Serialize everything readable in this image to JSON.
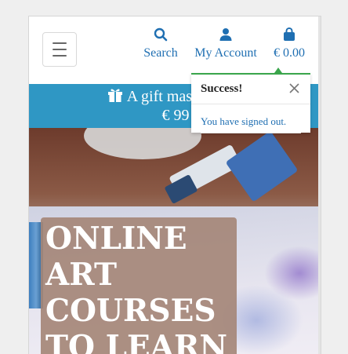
{
  "header": {
    "menu_toggle": "menu",
    "search_label": "Search",
    "account_label": "My Account",
    "bag_total": "€ 0.00"
  },
  "promo": {
    "line1": "A gift master-class",
    "line2": "€ 99"
  },
  "hero": {
    "headline_lines": [
      "ONLINE",
      "ART",
      "COURSES",
      "TO LEARN"
    ]
  },
  "toast": {
    "title": "Success!",
    "message": "You have signed out."
  },
  "colors": {
    "link": "#1f6fb2",
    "promo_bg": "#2f97c4",
    "success": "#3aa54b"
  },
  "icons": [
    "search-icon",
    "user-icon",
    "shopping-bag-icon",
    "gift-icon",
    "close-icon",
    "hamburger-icon"
  ]
}
